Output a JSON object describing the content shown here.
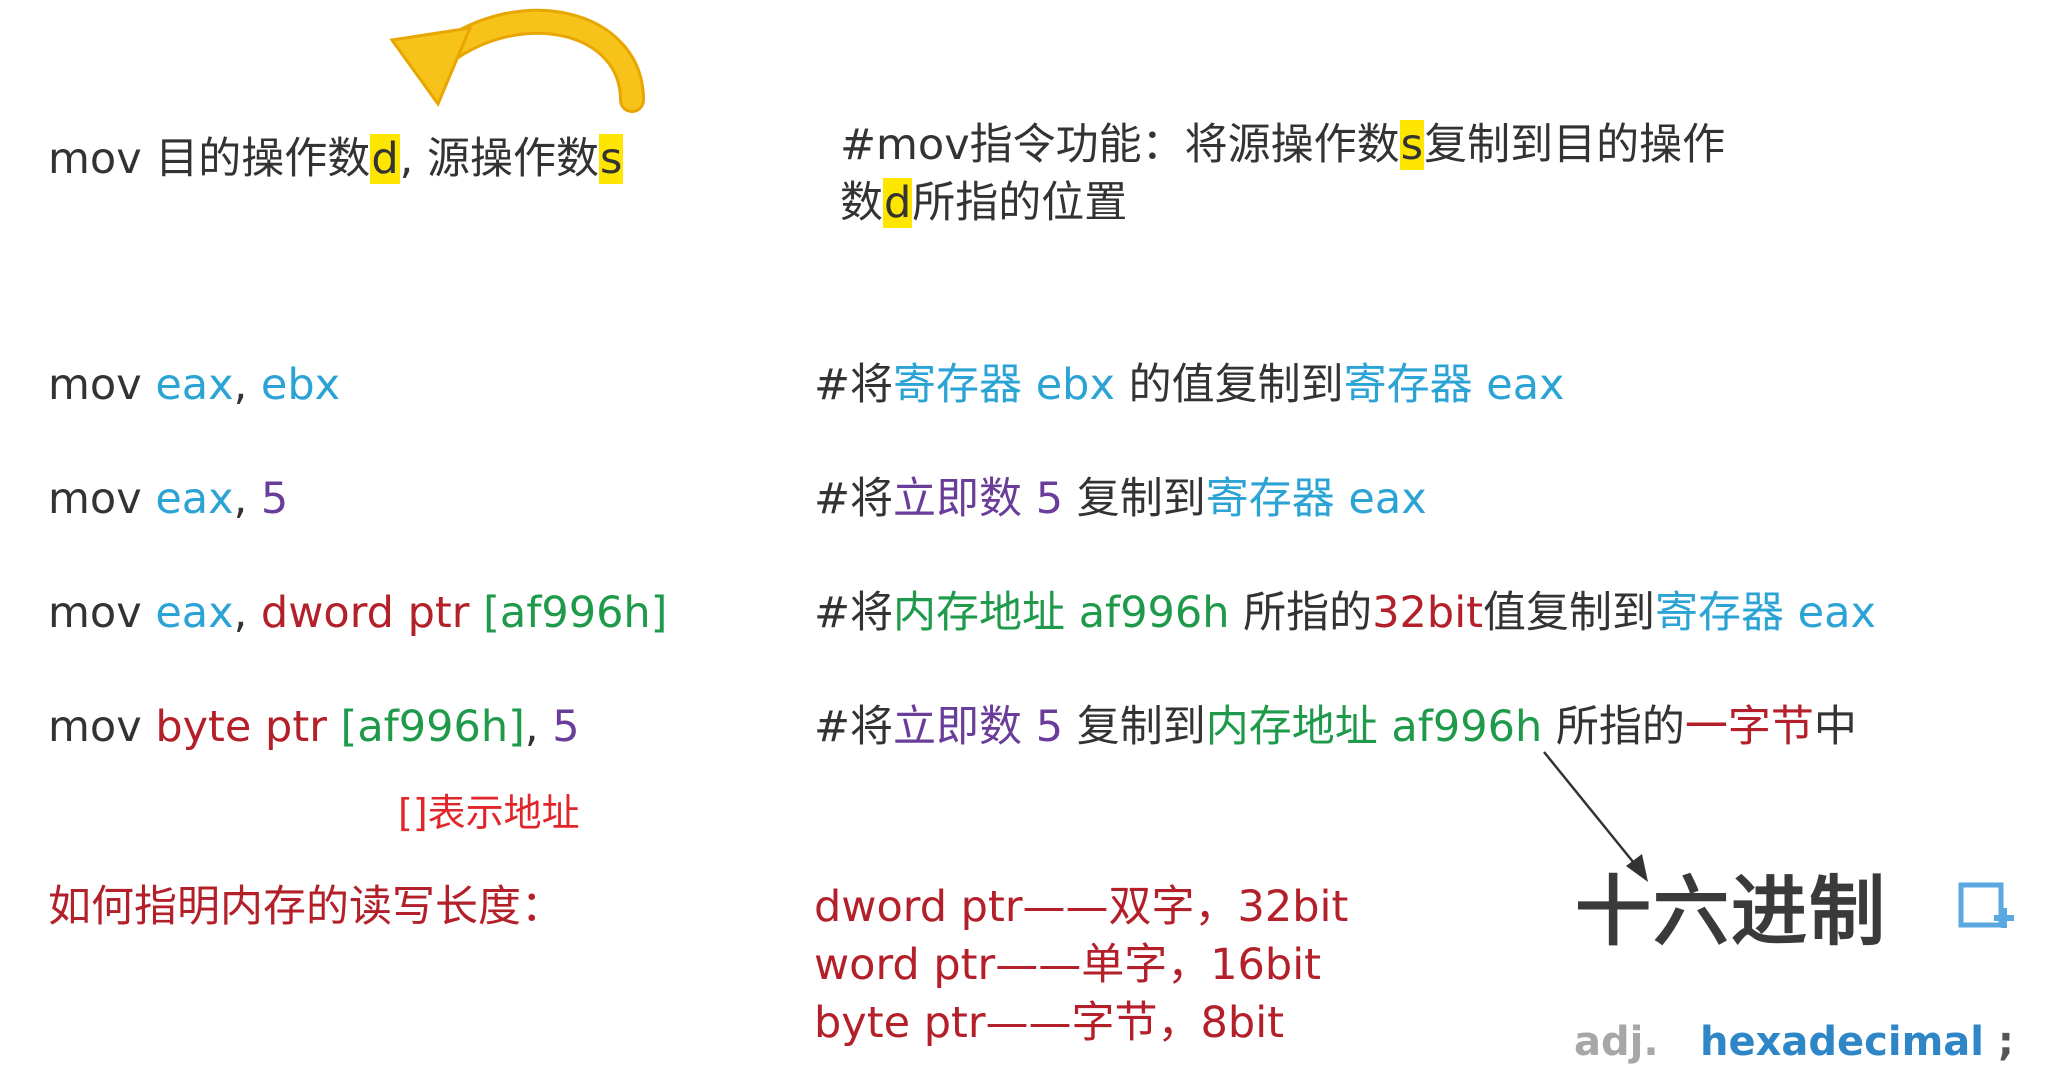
{
  "syntax": {
    "code_prefix": "mov ",
    "code_dest": "目的操作数",
    "code_d": "d",
    "code_sep": ", 源操作数",
    "code_s": "s",
    "desc_line1_pre": "#mov指令功能：将源操作数",
    "desc_s": "s",
    "desc_line1_post": "复制到目的操作",
    "desc_line2_pre": "数",
    "desc_d": "d",
    "desc_line2_post": "所指的位置"
  },
  "examples": [
    {
      "code": {
        "mov": "mov ",
        "a": "eax",
        "b": ", ",
        "c": "ebx"
      },
      "desc": {
        "h": "#将",
        "a": "寄存器 ebx",
        "b": " 的值复制到",
        "c": "寄存器 eax"
      }
    },
    {
      "code": {
        "mov": "mov ",
        "a": "eax",
        "b": ", ",
        "c": "5"
      },
      "desc": {
        "h": "#将",
        "a": "立即数 5",
        "b": " 复制到",
        "c": "寄存器 eax"
      }
    },
    {
      "code": {
        "mov": "mov ",
        "a": "eax",
        "b": ", ",
        "c": "dword ptr ",
        "d": "[af996h]"
      },
      "desc": {
        "h": "#将",
        "a": "内存地址 af996h",
        "b": " 所指的",
        "c": "32bit",
        "d": "值复制到",
        "e": "寄存器 eax"
      }
    },
    {
      "code": {
        "mov": "mov ",
        "a": "byte ptr ",
        "b": "[af996h]",
        "c": ", ",
        "d": "5"
      },
      "desc": {
        "h": "#将",
        "a": "立即数 5",
        "b": " 复制到",
        "c": "内存地址 af996h",
        "d": " 所指的",
        "e": "一字节",
        "f": "中"
      }
    }
  ],
  "bracket_note": "[]表示地址",
  "length_question": "如何指明内存的读写长度：",
  "lengths": [
    "dword ptr——双字，32bit",
    "word ptr——单字，16bit",
    "byte ptr——字节，8bit"
  ],
  "dictionary": {
    "term": "十六进制",
    "pos": "adj.",
    "translation": "hexadecimal",
    "trailing": " ;"
  },
  "colors": {
    "highlight": "#ffe600",
    "register": "#2ba3d4",
    "immediate": "#6a3d9a",
    "memory": "#1e9a4a",
    "size": "#b3202a",
    "arrow_curve": "#f5b800"
  }
}
